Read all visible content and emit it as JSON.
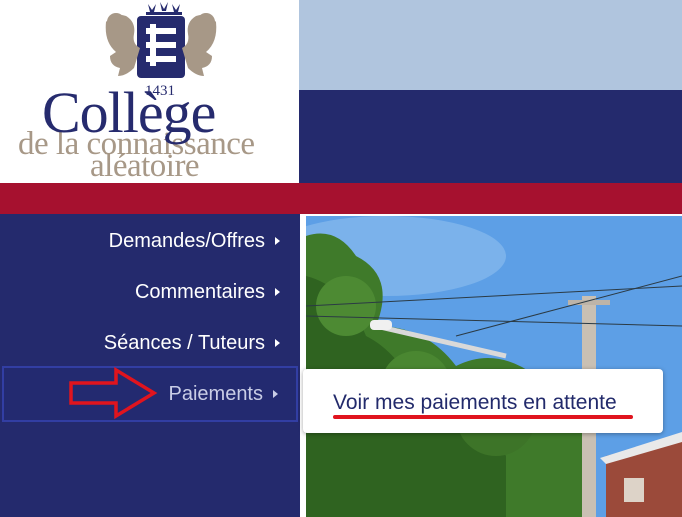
{
  "header": {
    "logo_year": "1431",
    "logo_title": "Collège",
    "logo_subtitle_line1": "de la connaissance",
    "logo_subtitle_line2": "aléatoire"
  },
  "sidebar": {
    "items": [
      {
        "label": "Demandes/Offres"
      },
      {
        "label": "Commentaires"
      },
      {
        "label": "Séances / Tuteurs"
      },
      {
        "label": "Paiements",
        "active": true
      }
    ]
  },
  "dropdown": {
    "item_label": "Voir mes paiements en attente"
  },
  "colors": {
    "navy": "#242a6d",
    "sky": "#b0c5de",
    "crimson": "#a6112f",
    "annotation_red": "#e0141e"
  },
  "icons": [
    "lion-crest-icon",
    "fleur-de-lis-icon",
    "caret-right-icon",
    "annotation-arrow-icon"
  ]
}
